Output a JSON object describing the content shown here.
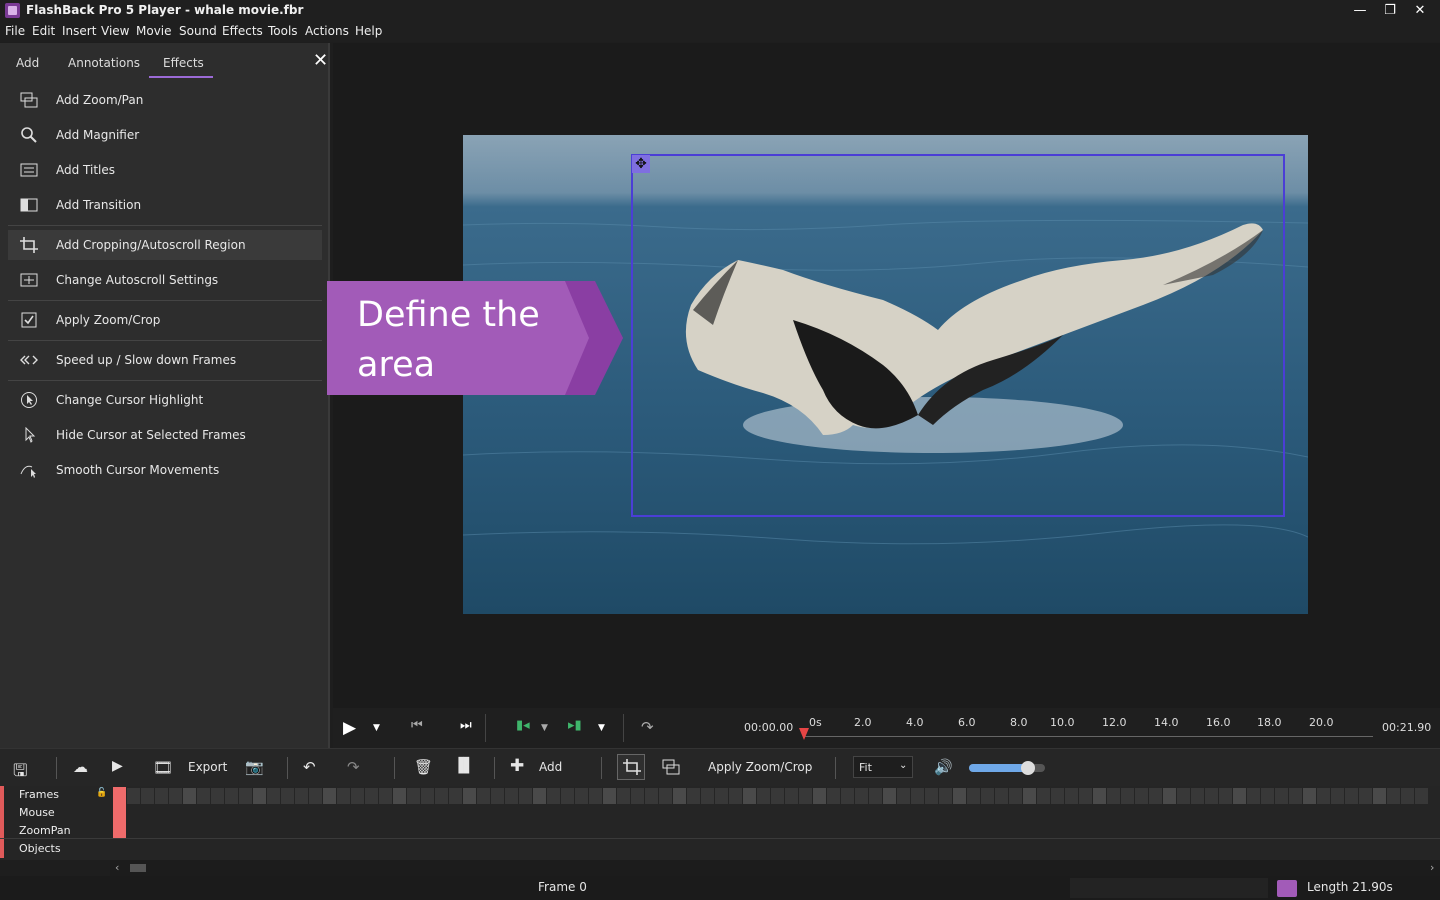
{
  "window": {
    "title": "FlashBack Pro 5 Player - whale movie.fbr",
    "min": "—",
    "restore": "❐",
    "close": "✕"
  },
  "menu": [
    "File",
    "Edit",
    "Insert",
    "View",
    "Movie",
    "Sound",
    "Effects",
    "Tools",
    "Actions",
    "Help"
  ],
  "panel": {
    "tabs": [
      "Add",
      "Annotations",
      "Effects"
    ],
    "active_tab": "Effects",
    "close": "✕",
    "items": [
      {
        "label": "Add Zoom/Pan",
        "icon": "zoom-pan-icon"
      },
      {
        "label": "Add Magnifier",
        "icon": "magnifier-icon"
      },
      {
        "label": "Add Titles",
        "icon": "titles-icon"
      },
      {
        "label": "Add Transition",
        "icon": "transition-icon"
      },
      {
        "label": "Add Cropping/Autoscroll Region",
        "icon": "crop-icon"
      },
      {
        "label": "Change Autoscroll Settings",
        "icon": "autoscroll-icon"
      },
      {
        "label": "Apply Zoom/Crop",
        "icon": "apply-icon"
      },
      {
        "label": "Speed up / Slow down Frames",
        "icon": "speed-icon"
      },
      {
        "label": "Change Cursor Highlight",
        "icon": "cursor-highlight-icon"
      },
      {
        "label": "Hide Cursor at Selected Frames",
        "icon": "hide-cursor-icon"
      },
      {
        "label": "Smooth Cursor Movements",
        "icon": "smooth-cursor-icon"
      }
    ]
  },
  "callout": {
    "line1": "Define the",
    "line2": "area"
  },
  "transport": {
    "time_current": "00:00.00",
    "time_total": "00:21.90",
    "ticks": [
      "0s",
      "2.0",
      "4.0",
      "6.0",
      "8.0",
      "10.0",
      "12.0",
      "14.0",
      "16.0",
      "18.0",
      "20.0"
    ]
  },
  "toolbar": {
    "export": "Export",
    "add": "Add",
    "apply_zoom_crop": "Apply Zoom/Crop",
    "zoom_option": "Fit"
  },
  "tracks": [
    "Frames",
    "Mouse",
    "ZoomPan",
    "Objects"
  ],
  "status": {
    "frame": "Frame 0",
    "length": "Length 21.90s"
  },
  "colors": {
    "accent": "#9b6ad6",
    "callout": "#a25bb8",
    "crop": "#4b3ed6",
    "frame_marker": "#ef6b6b"
  }
}
